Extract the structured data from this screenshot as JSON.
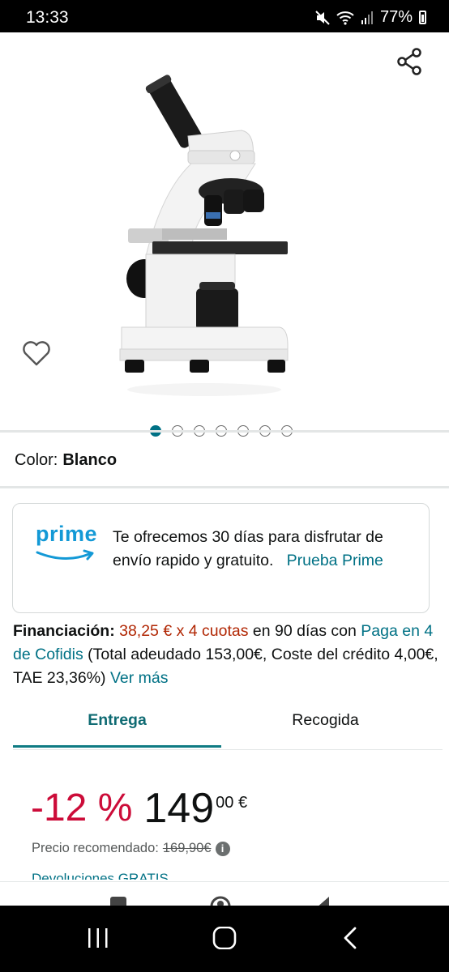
{
  "status_bar": {
    "time": "13:33",
    "battery": "77%"
  },
  "gallery": {
    "image_count": 7,
    "active_index": 0
  },
  "color": {
    "label": "Color:",
    "value": "Blanco"
  },
  "prime_card": {
    "logo_text": "prime",
    "text": "Te ofrecemos 30 días para disfrutar de envío rapido y gratuito.",
    "link": "Prueba Prime"
  },
  "financing": {
    "label": "Financiación:",
    "installments": "38,25 € x 4 cuotas",
    "text1": " en 90 días con ",
    "provider_link": "Paga en 4 de Cofidis",
    "text2": " (Total adeudado 153,00€, Coste del crédito 4,00€, TAE 23,36%) ",
    "more_link": "Ver más"
  },
  "tabs": {
    "delivery": "Entrega",
    "pickup": "Recogida",
    "active": "Entrega"
  },
  "price": {
    "discount": "-12 %",
    "whole": "149",
    "fraction": "00 €",
    "rrp_label": "Precio recomendado:",
    "rrp_value": "169,90€"
  },
  "returns": {
    "text": "Devoluciones GRATIS"
  },
  "colors": {
    "link": "#007185",
    "price": "#b12704",
    "discount": "#cc0c39",
    "prime": "#1399d6"
  }
}
